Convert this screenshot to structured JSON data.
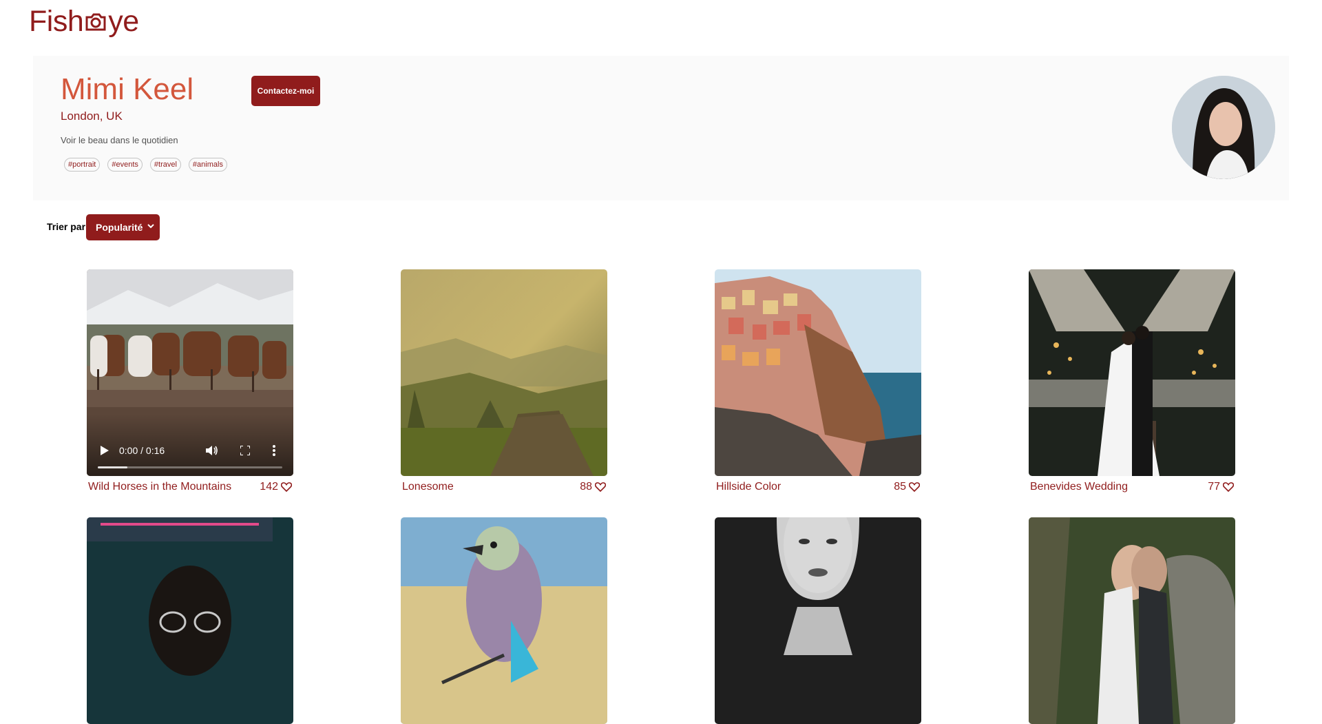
{
  "header": {
    "logo_text_before": "Fish",
    "logo_text_after": "ye",
    "logo_icon": "camera-icon"
  },
  "profile": {
    "name": "Mimi Keel",
    "location": "London, UK",
    "tagline": "Voir le beau dans le quotidien",
    "tags": [
      "#portrait",
      "#events",
      "#travel",
      "#animals"
    ],
    "contact_label": "Contactez-moi"
  },
  "sort": {
    "label": "Trier par",
    "selected": "Popularité"
  },
  "media": [
    {
      "title": "Wild Horses in the Mountains",
      "likes": "142",
      "type": "video",
      "time": "0:00 / 0:16",
      "progress": 0.16
    },
    {
      "title": "Lonesome",
      "likes": "88",
      "type": "image"
    },
    {
      "title": "Hillside Color",
      "likes": "85",
      "type": "image"
    },
    {
      "title": "Benevides Wedding",
      "likes": "77",
      "type": "image"
    },
    {
      "title": "",
      "likes": "",
      "type": "image"
    },
    {
      "title": "",
      "likes": "",
      "type": "image"
    },
    {
      "title": "",
      "likes": "",
      "type": "image"
    },
    {
      "title": "",
      "likes": "",
      "type": "image"
    }
  ],
  "colors": {
    "brand": "#901c1c",
    "name": "#d3573c",
    "banner_bg": "#fafafa"
  }
}
